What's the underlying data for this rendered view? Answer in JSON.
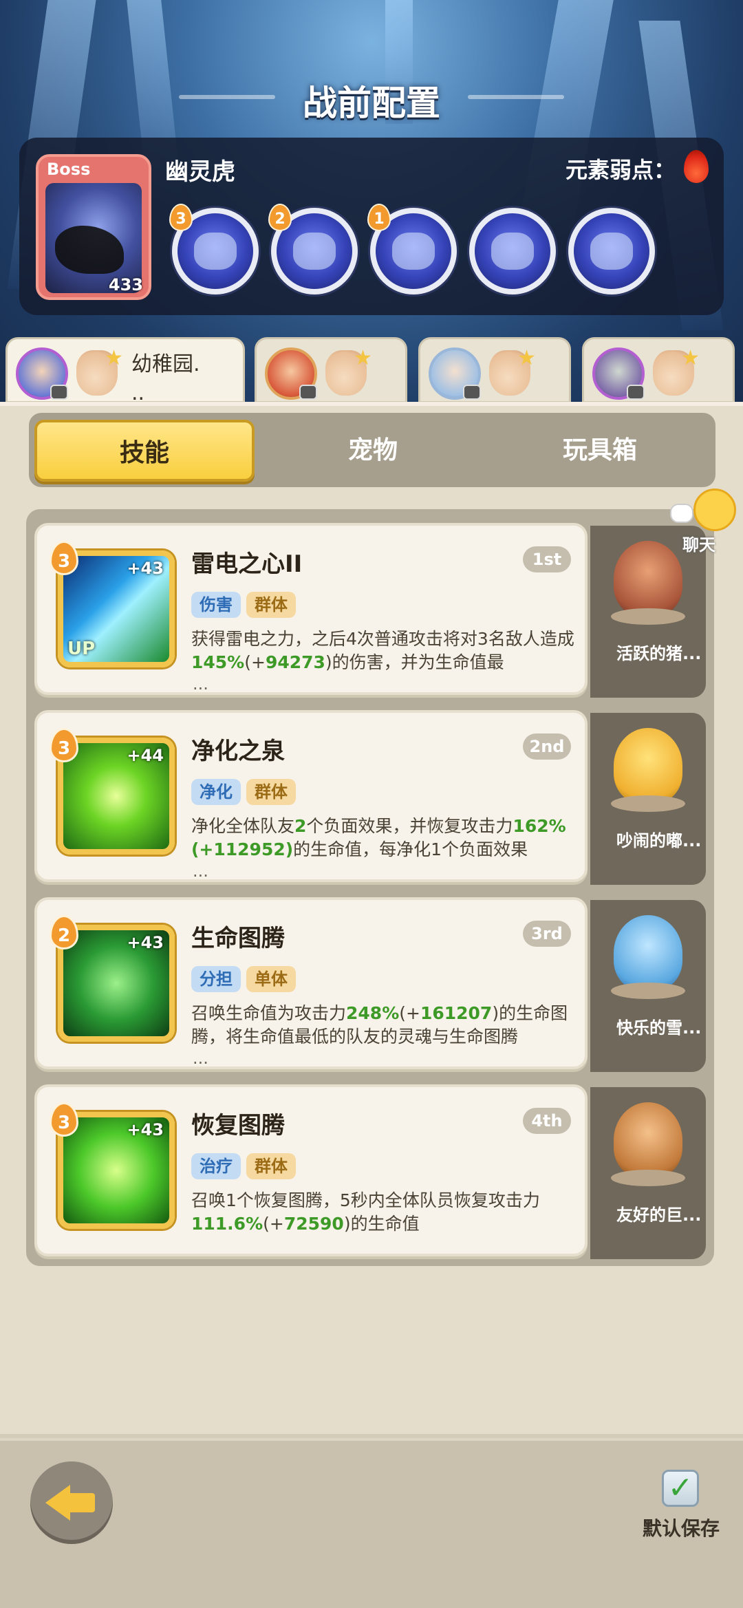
{
  "header": {
    "title": "战前配置"
  },
  "boss": {
    "tag": "Boss",
    "name": "幽灵虎",
    "level": "433",
    "weakness_label": "元素弱点：",
    "weakness_icon": "fire-icon",
    "skills": [
      {
        "badge": "3"
      },
      {
        "badge": "2"
      },
      {
        "badge": "1"
      },
      {
        "badge": ""
      },
      {
        "badge": ""
      }
    ]
  },
  "team_tabs": [
    {
      "name": "幼稚园.\n..",
      "active": true
    },
    {
      "name": "",
      "active": false
    },
    {
      "name": "",
      "active": false
    },
    {
      "name": "",
      "active": false
    }
  ],
  "tabs": [
    "技能",
    "宠物",
    "玩具箱"
  ],
  "chat": {
    "label": "聊天"
  },
  "skills": [
    {
      "level": "3",
      "plus": "+43",
      "up": "UP",
      "name": "雷电之心II",
      "rank": "1st",
      "tag1": "伤害",
      "tag2": "群体",
      "desc_a": "获得雷电之力，之后4次普通攻击将对3名敌人造成",
      "pct": "145%",
      "desc_b": "(+",
      "bonus": "94273",
      "desc_c": ")的伤害，并为生命值最",
      "more": "...",
      "pet": "活跃的猪..."
    },
    {
      "level": "3",
      "plus": "+44",
      "up": "",
      "name": "净化之泉",
      "rank": "2nd",
      "tag1": "净化",
      "tag2": "群体",
      "desc_a": "净化全体队友",
      "pct": "2",
      "desc_b": "个负面效果，并恢复攻击力",
      "bonus": "162%(+112952)",
      "desc_c": "的生命值，每净化1个负面效果",
      "more": "...",
      "pet": "吵闹的嘟..."
    },
    {
      "level": "2",
      "plus": "+43",
      "up": "",
      "name": "生命图腾",
      "rank": "3rd",
      "tag1": "分担",
      "tag2": "单体",
      "desc_a": "召唤生命值为攻击力",
      "pct": "248%",
      "desc_b": "(+",
      "bonus": "161207",
      "desc_c": ")的生命图腾，将生命值最低的队友的灵魂与生命图腾",
      "more": "...",
      "pet": "快乐的雪..."
    },
    {
      "level": "3",
      "plus": "+43",
      "up": "",
      "name": "恢复图腾",
      "rank": "4th",
      "tag1": "治疗",
      "tag2": "群体",
      "desc_a": "召唤1个恢复图腾，5秒内全体队员恢复攻击力",
      "pct": "111.6%",
      "desc_b": "(+",
      "bonus": "72590",
      "desc_c": ")的生命值",
      "more": "",
      "pet": "友好的巨..."
    }
  ],
  "footer": {
    "save_label": "默认保存"
  }
}
